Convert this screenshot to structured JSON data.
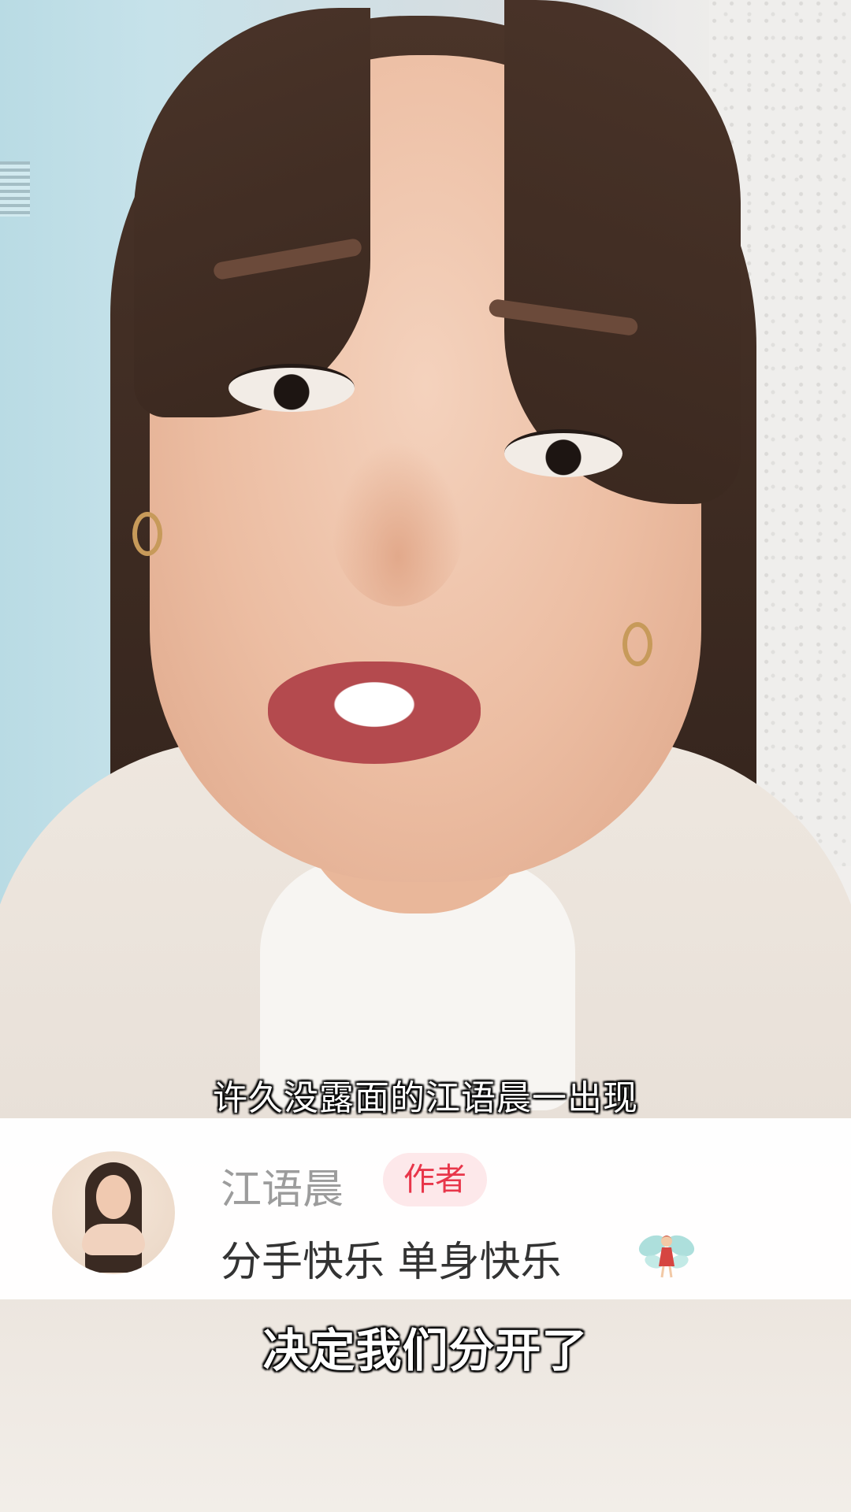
{
  "video": {
    "subtitle_top": "许久没露面的江语晨一出现",
    "subtitle_bottom": "决定我们分开了"
  },
  "comment": {
    "author_name": "江语晨",
    "author_badge": "作者",
    "text": "分手快乐 单身快乐",
    "emoji": "fairy-emoji"
  },
  "colors": {
    "badge_text": "#e8364a",
    "badge_bg": "#fde8ea",
    "author_name": "#9c9c9c",
    "comment_text": "#333333"
  }
}
